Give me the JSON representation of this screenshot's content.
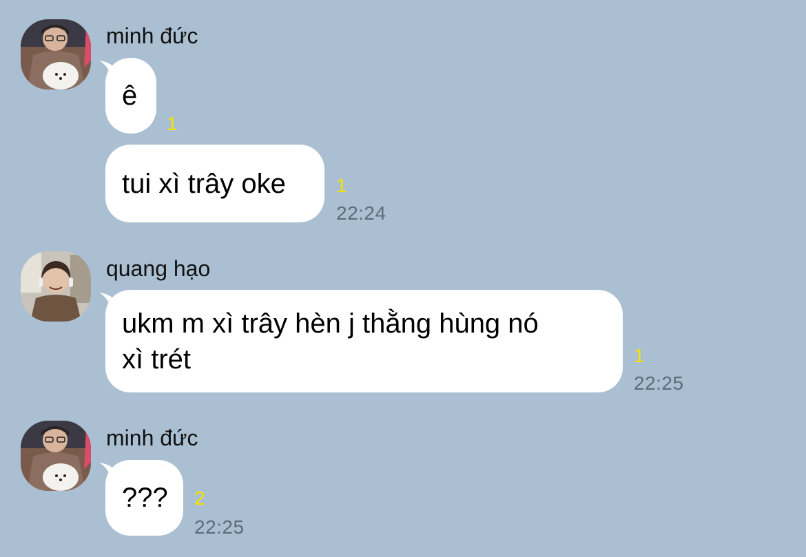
{
  "messages": [
    {
      "sender": "minh đức",
      "bubbles": [
        {
          "text": "ê",
          "unread": "1",
          "time": ""
        },
        {
          "text": "tui xì trây oke",
          "unread": "1",
          "time": "22:24"
        }
      ]
    },
    {
      "sender": "quang hạo",
      "bubbles": [
        {
          "text": "ukm m xì trây hèn j thằng hùng nó\nxì trét",
          "unread": "1",
          "time": "22:25"
        }
      ]
    },
    {
      "sender": "minh đức",
      "bubbles": [
        {
          "text": "???",
          "unread": "2",
          "time": "22:25"
        }
      ]
    }
  ],
  "colors": {
    "background": "#aabfd2",
    "bubble": "#ffffff",
    "unread": "#f2e300",
    "time": "#5f6b78"
  }
}
